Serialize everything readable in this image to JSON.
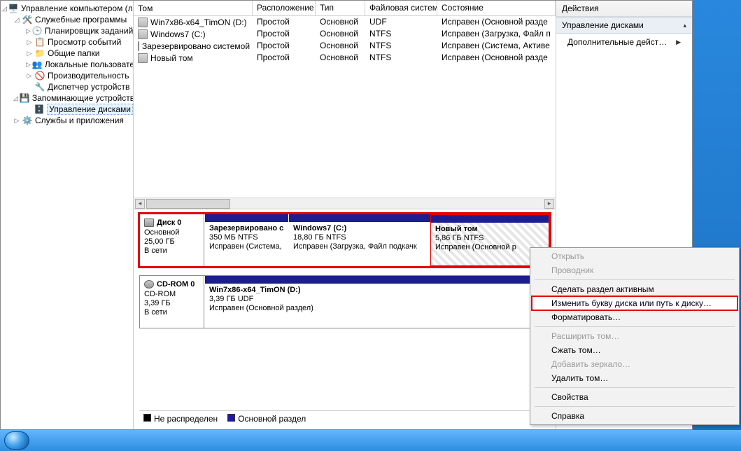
{
  "tree": {
    "root": "Управление компьютером (ло",
    "sys_tools": "Служебные программы",
    "sched": "Планировщик заданий",
    "eventv": "Просмотр событий",
    "shared": "Общие папки",
    "users": "Локальные пользовате",
    "perf": "Производительность",
    "devmgr": "Диспетчер устройств",
    "storage": "Запоминающие устройства",
    "diskmgmt": "Управление дисками",
    "svc": "Службы и приложения"
  },
  "vol_head": {
    "vol": "Том",
    "layout": "Расположение",
    "type": "Тип",
    "fs": "Файловая система",
    "status": "Состояние"
  },
  "vol_rows": [
    {
      "v": "Win7x86-x64_TimON (D:)",
      "l": "Простой",
      "t": "Основной",
      "f": "UDF",
      "s": "Исправен (Основной разде"
    },
    {
      "v": "Windows7 (C:)",
      "l": "Простой",
      "t": "Основной",
      "f": "NTFS",
      "s": "Исправен (Загрузка, Файл п"
    },
    {
      "v": "Зарезервировано системой",
      "l": "Простой",
      "t": "Основной",
      "f": "NTFS",
      "s": "Исправен (Система, Активе"
    },
    {
      "v": "Новый том",
      "l": "Простой",
      "t": "Основной",
      "f": "NTFS",
      "s": "Исправен (Основной разде"
    }
  ],
  "disk0": {
    "title": "Диск 0",
    "type": "Основной",
    "size": "25,00 ГБ",
    "state": "В сети",
    "parts": [
      {
        "name": "Зарезервировано с",
        "size": "350 МБ NTFS",
        "status": "Исправен (Система,"
      },
      {
        "name": "Windows7  (C:)",
        "size": "18,80 ГБ NTFS",
        "status": "Исправен (Загрузка, Файл подкачк"
      },
      {
        "name": "Новый том",
        "size": "5,86 ГБ NTFS",
        "status": "Исправен (Основной р"
      }
    ]
  },
  "cdrom": {
    "title": "CD-ROM 0",
    "type": "CD-ROM",
    "size": "3,39 ГБ",
    "state": "В сети",
    "part": {
      "name": "Win7x86-x64_TimON (D:)",
      "size": "3,39 ГБ UDF",
      "status": "Исправен (Основной раздел)"
    }
  },
  "legend": {
    "unalloc": "Не распределен",
    "primary": "Основной раздел"
  },
  "actions": {
    "title": "Действия",
    "section": "Управление дисками",
    "more": "Дополнительные дейст…"
  },
  "menu": {
    "open": "Открыть",
    "explorer": "Проводник",
    "active": "Сделать раздел активным",
    "change_letter": "Изменить букву диска или путь к диску…",
    "format": "Форматировать…",
    "extend": "Расширить том…",
    "shrink": "Сжать том…",
    "mirror": "Добавить зеркало…",
    "delete": "Удалить том…",
    "props": "Свойства",
    "help": "Справка"
  }
}
